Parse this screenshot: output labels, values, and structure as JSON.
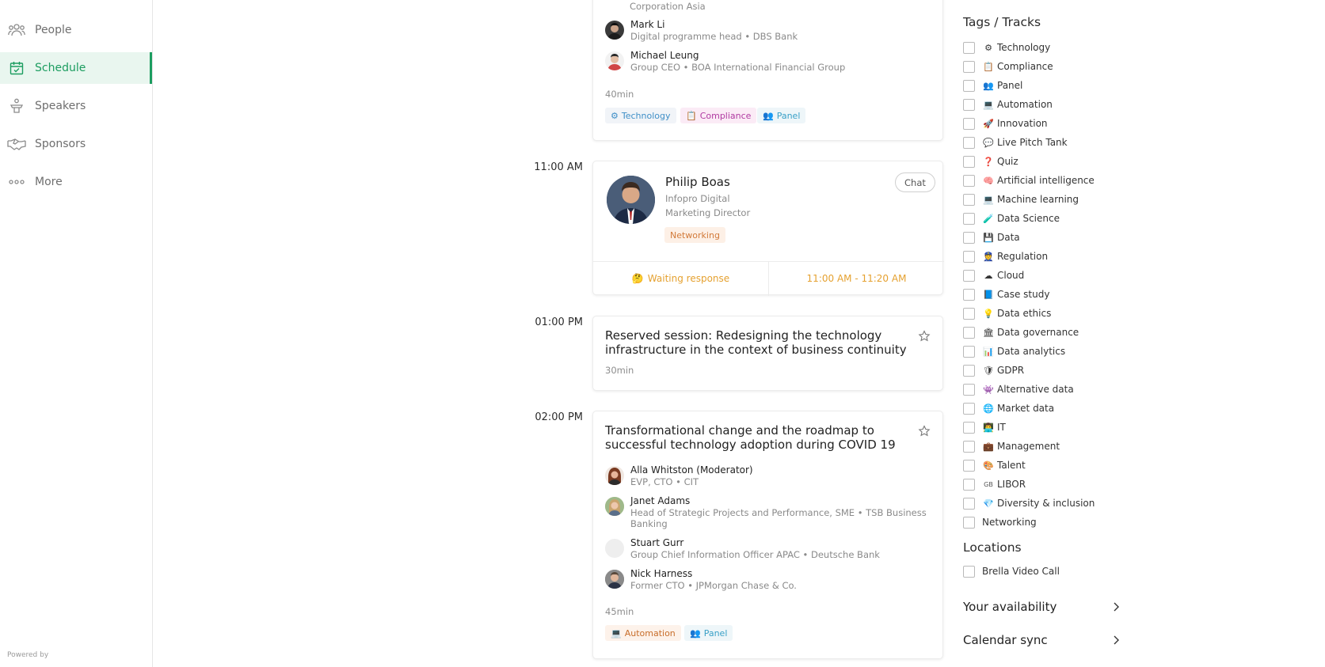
{
  "sidebar": {
    "items": [
      {
        "label": "People",
        "icon": "people-icon"
      },
      {
        "label": "Schedule",
        "icon": "calendar-check-icon"
      },
      {
        "label": "Speakers",
        "icon": "podium-icon"
      },
      {
        "label": "Sponsors",
        "icon": "handshake-icon"
      },
      {
        "label": "More",
        "icon": "more-dots-icon"
      }
    ],
    "powered_by": "Powered by"
  },
  "sessions": {
    "first": {
      "org_tail": "Corporation Asia",
      "speakers": [
        {
          "name": "Mark Li",
          "role": "Digital programme head • DBS Bank"
        },
        {
          "name": "Michael Leung",
          "role": "Group CEO • BOA International Financial Group"
        }
      ],
      "duration": "40min",
      "tags": [
        "Technology",
        "Compliance",
        "Panel"
      ]
    },
    "meeting": {
      "time": "11:00 AM",
      "name": "Philip Boas",
      "company": "Infopro Digital",
      "title": "Marketing Director",
      "tag": "Networking",
      "chat": "Chat",
      "status": "Waiting response",
      "range": "11:00 AM - 11:20 AM"
    },
    "reserved": {
      "time": "01:00 PM",
      "title_line1": "Reserved session: Redesigning the technology",
      "title_line2": "infrastructure in the context of business continuity",
      "duration": "30min"
    },
    "covid": {
      "time": "02:00 PM",
      "title_line1": "Transformational change and the roadmap to",
      "title_line2": "successful technology adoption during COVID 19",
      "speakers": [
        {
          "name": "Alla Whitston (Moderator)",
          "role": "EVP, CTO • CIT"
        },
        {
          "name": "Janet Adams",
          "role": "Head of Strategic Projects and Performance, SME • TSB Business",
          "role2": "Banking"
        },
        {
          "name": "Stuart Gurr",
          "role": "Group Chief Information Officer APAC • Deutsche Bank"
        },
        {
          "name": "Nick Harness",
          "role": "Former CTO • JPMorgan Chase & Co."
        }
      ],
      "duration": "45min",
      "tags": [
        "Automation",
        "Panel"
      ]
    }
  },
  "filters": {
    "tags_heading": "Tags / Tracks",
    "tags": [
      {
        "label": "Technology",
        "icon": "⚙"
      },
      {
        "label": "Compliance",
        "icon": "📋"
      },
      {
        "label": "Panel",
        "icon": "👥"
      },
      {
        "label": "Automation",
        "icon": "💻"
      },
      {
        "label": "Innovation",
        "icon": "🚀"
      },
      {
        "label": "Live Pitch Tank",
        "icon": "💬"
      },
      {
        "label": "Quiz",
        "icon": "❓"
      },
      {
        "label": "Artificial intelligence",
        "icon": "🧠"
      },
      {
        "label": "Machine learning",
        "icon": "💻"
      },
      {
        "label": "Data Science",
        "icon": "🧪"
      },
      {
        "label": "Data",
        "icon": "💾"
      },
      {
        "label": "Regulation",
        "icon": "👮"
      },
      {
        "label": "Cloud",
        "icon": "☁"
      },
      {
        "label": "Case study",
        "icon": "📘"
      },
      {
        "label": "Data ethics",
        "icon": "💡"
      },
      {
        "label": "Data governance",
        "icon": "🏛"
      },
      {
        "label": "Data analytics",
        "icon": "📊"
      },
      {
        "label": "GDPR",
        "icon": "🛡"
      },
      {
        "label": "Alternative data",
        "icon": "👾"
      },
      {
        "label": "Market data",
        "icon": "🌐"
      },
      {
        "label": "IT",
        "icon": "👨‍💻"
      },
      {
        "label": "Management",
        "icon": "💼"
      },
      {
        "label": "Talent",
        "icon": "🎨"
      },
      {
        "label": "LIBOR",
        "icon": "GB"
      },
      {
        "label": "Diversity & inclusion",
        "icon": "💎"
      },
      {
        "label": "Networking",
        "icon": ""
      }
    ],
    "locations_heading": "Locations",
    "locations": [
      {
        "label": "Brella Video Call"
      }
    ],
    "availability": "Your availability",
    "calendar": "Calendar sync"
  },
  "colors": {
    "accent": "#1c9d60",
    "warning": "#e5a130"
  }
}
